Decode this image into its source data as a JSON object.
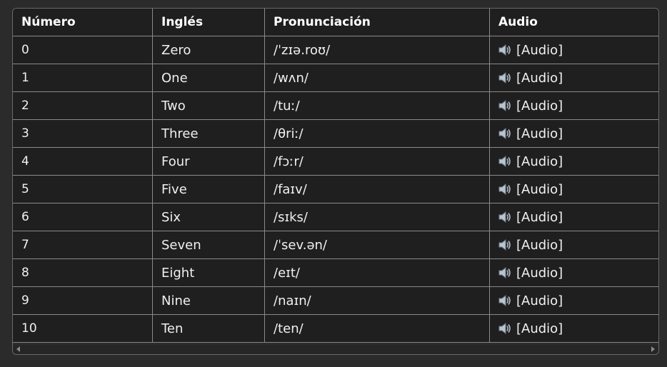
{
  "table": {
    "headers": [
      "Número",
      "Inglés",
      "Pronunciación",
      "Audio"
    ],
    "rows": [
      {
        "numero": "0",
        "ingles": "Zero",
        "pron": "/ˈzɪə.roʊ/",
        "audio": "[Audio]"
      },
      {
        "numero": "1",
        "ingles": "One",
        "pron": "/wʌn/",
        "audio": "[Audio]"
      },
      {
        "numero": "2",
        "ingles": "Two",
        "pron": "/tuː/",
        "audio": "[Audio]"
      },
      {
        "numero": "3",
        "ingles": "Three",
        "pron": "/θriː/",
        "audio": "[Audio]"
      },
      {
        "numero": "4",
        "ingles": "Four",
        "pron": "/fɔːr/",
        "audio": "[Audio]"
      },
      {
        "numero": "5",
        "ingles": "Five",
        "pron": "/faɪv/",
        "audio": "[Audio]"
      },
      {
        "numero": "6",
        "ingles": "Six",
        "pron": "/sɪks/",
        "audio": "[Audio]"
      },
      {
        "numero": "7",
        "ingles": "Seven",
        "pron": "/ˈsev.ən/",
        "audio": "[Audio]"
      },
      {
        "numero": "8",
        "ingles": "Eight",
        "pron": "/eɪt/",
        "audio": "[Audio]"
      },
      {
        "numero": "9",
        "ingles": "Nine",
        "pron": "/naɪn/",
        "audio": "[Audio]"
      },
      {
        "numero": "10",
        "ingles": "Ten",
        "pron": "/ten/",
        "audio": "[Audio]"
      }
    ],
    "audio_icon": "speaker-icon"
  }
}
